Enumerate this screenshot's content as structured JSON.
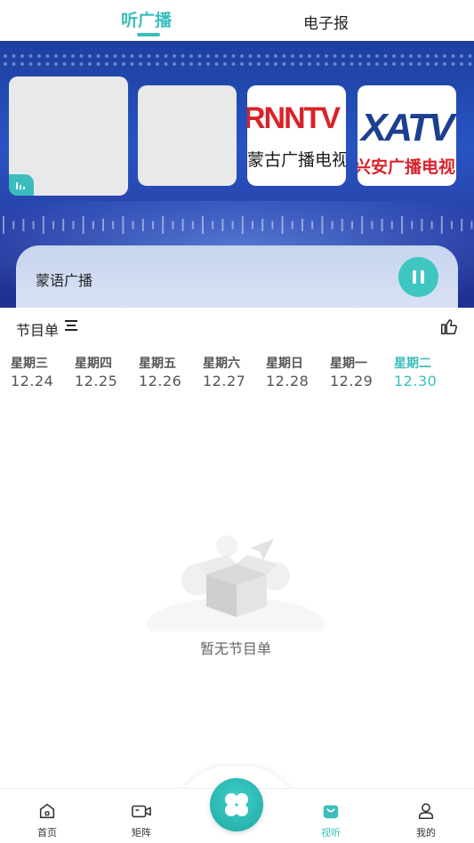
{
  "tabs": {
    "listen": "听广播",
    "newspaper": "电子报"
  },
  "stations": [
    {
      "name": ""
    },
    {
      "name": ""
    },
    {
      "logo_text_top": "RNNTV",
      "logo_text_bottom": "蒙古广播电视"
    },
    {
      "logo_text_top": "XATV",
      "logo_text_bottom": "兴安广播电视"
    }
  ],
  "now_playing": {
    "title": "蒙语广播"
  },
  "program": {
    "title": "节目单"
  },
  "dates": [
    {
      "weekday": "星期三",
      "date": "12.24"
    },
    {
      "weekday": "星期四",
      "date": "12.25"
    },
    {
      "weekday": "星期五",
      "date": "12.26"
    },
    {
      "weekday": "星期六",
      "date": "12.27"
    },
    {
      "weekday": "星期日",
      "date": "12.28"
    },
    {
      "weekday": "星期一",
      "date": "12.29"
    },
    {
      "weekday": "星期二",
      "date": "12.30"
    }
  ],
  "selected_date_index": 6,
  "empty_state": {
    "text": "暂无节目单"
  },
  "bottom_nav": [
    {
      "label": "首页",
      "icon": "home-icon"
    },
    {
      "label": "矩阵",
      "icon": "video-camera-icon"
    },
    {
      "label": "",
      "icon": "clover-icon"
    },
    {
      "label": "视听",
      "icon": "audio-bag-icon"
    },
    {
      "label": "我的",
      "icon": "user-icon"
    }
  ],
  "colors": {
    "accent": "#3bbdbd",
    "banner": "#2754c2"
  }
}
